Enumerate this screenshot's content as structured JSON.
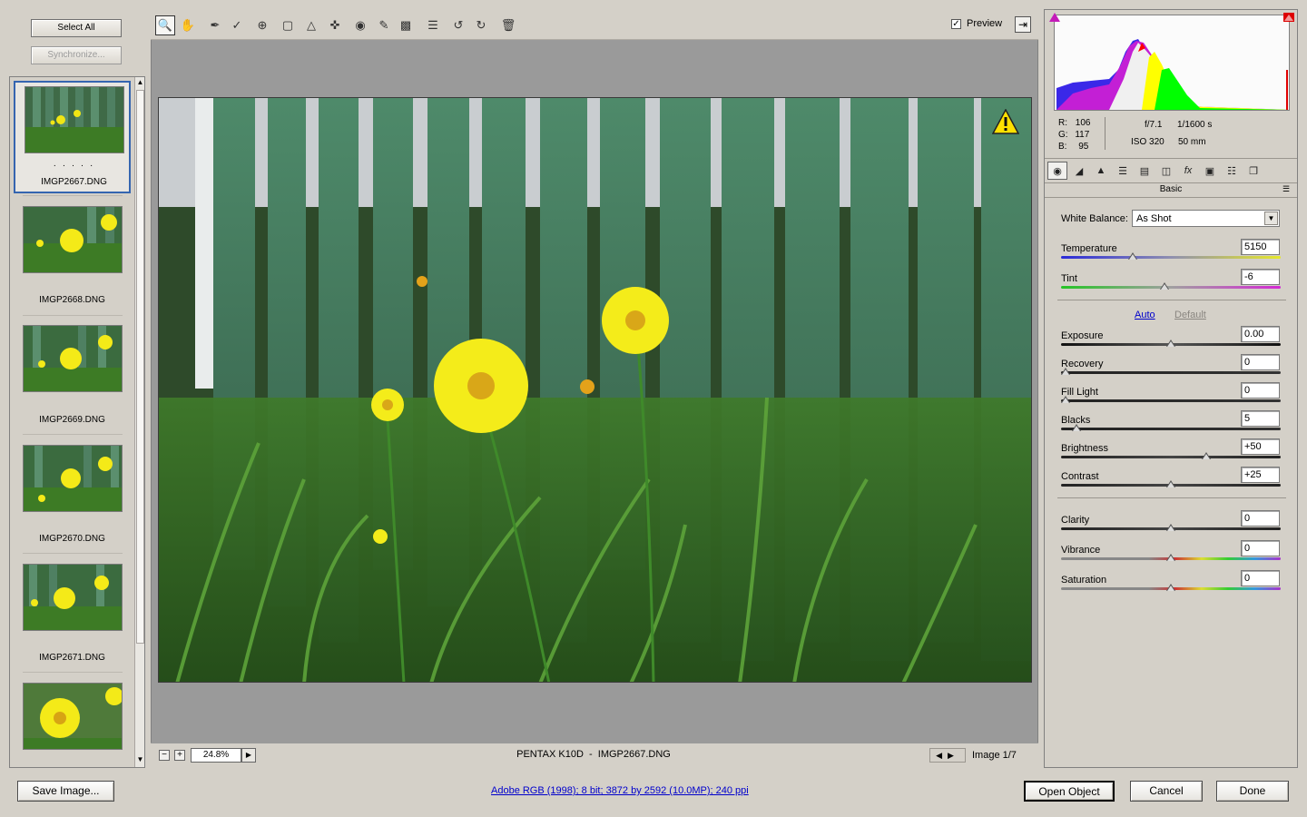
{
  "left_panel": {
    "select_all_label": "Select All",
    "synchronize_label": "Synchronize...",
    "thumbnails": [
      {
        "name": "IMGP2667.DNG",
        "rating": "· · · · ·",
        "selected": true
      },
      {
        "name": "IMGP2668.DNG"
      },
      {
        "name": "IMGP2669.DNG"
      },
      {
        "name": "IMGP2670.DNG"
      },
      {
        "name": "IMGP2671.DNG"
      },
      {
        "name": ""
      }
    ]
  },
  "toolbar": {
    "tools": [
      "zoom-tool",
      "hand-tool",
      "white-balance-tool",
      "color-sampler-tool",
      "targeted-adjustment-tool",
      "crop-tool",
      "straighten-tool",
      "spot-removal-tool",
      "red-eye-tool",
      "adjustment-brush-tool",
      "graduated-filter-tool",
      "preferences-tool",
      "rotate-left-tool",
      "rotate-right-tool",
      "trash-tool"
    ],
    "preview_label": "Preview",
    "preview_checked": true
  },
  "preview": {
    "warning_icon": "warning-triangle-icon",
    "zoom_value": "24.8%",
    "caption": "PENTAX K10D  -  IMGP2667.DNG",
    "image_counter": "Image 1/7"
  },
  "info": {
    "r_label": "R:",
    "r_value": "106",
    "g_label": "G:",
    "g_value": "117",
    "b_label": "B:",
    "b_value": "95",
    "aperture": "f/7.1",
    "shutter": "1/1600 s",
    "iso": "ISO 320",
    "focal": "50 mm"
  },
  "panel": {
    "title": "Basic",
    "white_balance_label": "White Balance:",
    "white_balance_value": "As Shot",
    "auto_label": "Auto",
    "default_label": "Default",
    "sliders": [
      {
        "label": "Temperature",
        "value": "5150",
        "level": 0.32
      },
      {
        "label": "Tint",
        "value": "-6",
        "level": 0.47
      },
      {
        "label": "Exposure",
        "value": "0.00",
        "level": 0.5
      },
      {
        "label": "Recovery",
        "value": "0",
        "level": 0.0
      },
      {
        "label": "Fill Light",
        "value": "0",
        "level": 0.0
      },
      {
        "label": "Blacks",
        "value": "5",
        "level": 0.05
      },
      {
        "label": "Brightness",
        "value": "+50",
        "level": 0.67
      },
      {
        "label": "Contrast",
        "value": "+25",
        "level": 0.5
      },
      {
        "label": "Clarity",
        "value": "0",
        "level": 0.5
      },
      {
        "label": "Vibrance",
        "value": "0",
        "level": 0.5
      },
      {
        "label": "Saturation",
        "value": "0",
        "level": 0.5
      }
    ]
  },
  "footer": {
    "save_label": "Save Image...",
    "workflow_link": "Adobe RGB (1998); 8 bit; 3872 by 2592 (10.0MP); 240 ppi",
    "open_label": "Open Object",
    "cancel_label": "Cancel",
    "done_label": "Done"
  },
  "colors": {
    "selection": "#3565b0",
    "link": "#0000cc",
    "preview_bg": "#9a9a9a"
  }
}
